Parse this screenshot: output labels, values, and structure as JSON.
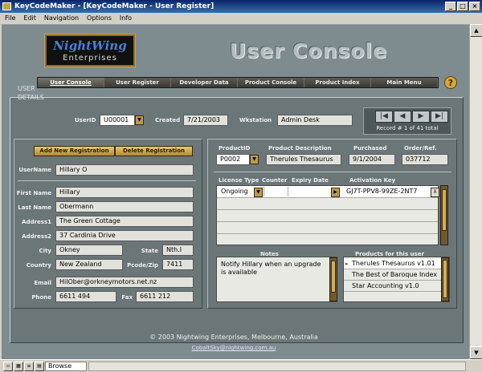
{
  "window": {
    "title": "KeyCodeMaker - [KeyCodeMaker - User Register]"
  },
  "menu": [
    "File",
    "Edit",
    "Navigation",
    "Options",
    "Info"
  ],
  "logo": {
    "line1": "NightWing",
    "line2": "Enterprises"
  },
  "console_title": "User Console",
  "nav": [
    "User Console",
    "User Register",
    "Developer Data",
    "Product Console",
    "Product Index",
    "Main Menu"
  ],
  "help_label": "?",
  "user_details": {
    "label": "USER DETAILS",
    "userid_label": "UserID",
    "userid": "U00001",
    "created_label": "Created",
    "created": "7/21/2003",
    "wkstation_label": "Wkstation",
    "wkstation": "Admin Desk"
  },
  "record_nav": {
    "first": "|◀",
    "prev": "◀",
    "next": "▶",
    "last": "▶|",
    "count": "Record # 1 of 41 total"
  },
  "buttons": {
    "add": "Add New Registration",
    "delete": "Delete Registration"
  },
  "user": {
    "username_label": "UserName",
    "username": "Hillary O",
    "first_label": "First Name",
    "first": "Hillary",
    "last_label": "Last Name",
    "last": "Obermann",
    "addr1_label": "Address1",
    "addr1": "The Green Cottage",
    "addr2_label": "Address2",
    "addr2": "37 Cardinia Drive",
    "city_label": "City",
    "city": "Okney",
    "state_label": "State",
    "state": "Nth.I",
    "country_label": "Country",
    "country": "New Zealand",
    "pcode_label": "Pcode/Zip",
    "pcode": "7411",
    "email_label": "Email",
    "email": "HilOber@orkneymotors.net.nz",
    "phone_label": "Phone",
    "phone": "6611 494",
    "fax_label": "Fax",
    "fax": "6611 212"
  },
  "product": {
    "id_label": "ProductID",
    "id": "P0002",
    "desc_label": "Product Description",
    "desc": "Therules Thesaurus",
    "purchased_label": "Purchased",
    "purchased": "9/1/2004",
    "order_label": "Order/Ref.",
    "order": "037712"
  },
  "license": {
    "headers": [
      "License Type",
      "Counter",
      "Expiry Date",
      "Activation Key"
    ],
    "row": {
      "type": "Ongoing",
      "counter": "",
      "expiry": "",
      "key": "GJ7T-PPV8-99ZE-2NT7",
      "delete": "X"
    }
  },
  "notes": {
    "label": "Notes",
    "text": "Notify Hillary when an upgrade is available"
  },
  "products_for_user": {
    "label": "Products for this user",
    "items": [
      "Therules Thesaurus v1.01",
      "The Best of Baroque Index",
      "Star Accounting v1.0"
    ]
  },
  "footer": {
    "copyright": "© 2003 Nightwing Enterprises, Melbourne, Australia",
    "email": "CobaltSky@nightwing.com.au"
  },
  "status": {
    "mode": "Browse"
  }
}
